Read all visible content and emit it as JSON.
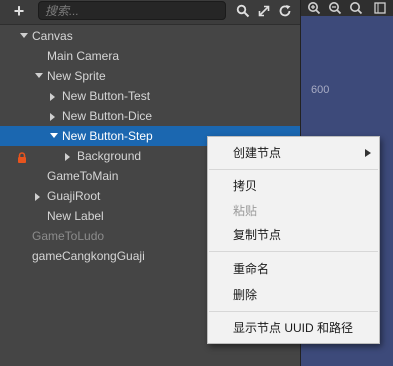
{
  "toolbar": {
    "search_placeholder": "搜索..."
  },
  "tree": [
    {
      "label": "Canvas",
      "expanded": true,
      "has_children": true,
      "selected": false,
      "dim": false
    },
    {
      "label": "Main Camera",
      "has_children": false,
      "selected": false,
      "dim": false
    },
    {
      "label": "New Sprite",
      "expanded": true,
      "has_children": true,
      "selected": false,
      "dim": false
    },
    {
      "label": "New Button-Test",
      "expanded": false,
      "has_children": true,
      "selected": false,
      "dim": false
    },
    {
      "label": "New Button-Dice",
      "expanded": false,
      "has_children": true,
      "selected": false,
      "dim": false
    },
    {
      "label": "New Button-Step",
      "expanded": true,
      "has_children": true,
      "selected": true,
      "dim": false
    },
    {
      "label": "Background",
      "expanded": false,
      "has_children": true,
      "selected": false,
      "dim": false,
      "locked": true
    },
    {
      "label": "GameToMain",
      "has_children": false,
      "selected": false,
      "dim": false
    },
    {
      "label": "GuajiRoot",
      "expanded": false,
      "has_children": true,
      "selected": false,
      "dim": false
    },
    {
      "label": "New Label",
      "has_children": false,
      "selected": false,
      "dim": false
    },
    {
      "label": "GameToLudo",
      "has_children": false,
      "selected": false,
      "dim": true
    },
    {
      "label": "gameCangkongGuaji",
      "has_children": false,
      "selected": false,
      "dim": false
    }
  ],
  "scene": {
    "ruler_label": "600"
  },
  "context_menu": {
    "items": [
      {
        "label": "创建节点",
        "disabled": false,
        "submenu": true
      },
      {
        "label": "拷贝",
        "disabled": false
      },
      {
        "label": "粘贴",
        "disabled": true
      },
      {
        "label": "复制节点",
        "disabled": false
      },
      {
        "label": "重命名",
        "disabled": false
      },
      {
        "label": "删除",
        "disabled": false
      },
      {
        "label": "显示节点 UUID 和路径",
        "disabled": false
      }
    ]
  },
  "colors": {
    "selection": "#1b67b0",
    "panel_bg": "#454545",
    "lock": "#e8541e",
    "scene_bg": "#3d4a7a"
  }
}
